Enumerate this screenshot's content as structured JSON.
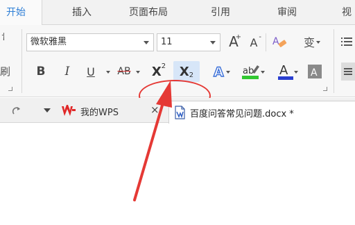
{
  "tabs": [
    "开始",
    "插入",
    "页面布局",
    "引用",
    "审阅",
    "视"
  ],
  "ribbon": {
    "left_char": "刷",
    "font_name": "微软雅黑",
    "font_size": "11",
    "bold": "B",
    "italic": "I",
    "underline": "U",
    "strike": "AB",
    "superscript_base": "X",
    "superscript_mark": "2",
    "subscript_base": "X",
    "subscript_mark": "2",
    "grow_font": "A",
    "shrink_font": "A",
    "clear_format_char": "A",
    "phonetic_char": "变"
  },
  "docbar": {
    "wps_label": "我的WPS",
    "close_glyph": "×",
    "file_title": "百度问答常见问题.docx *"
  },
  "colors": {
    "accent": "#2f7fd6",
    "highlight": "#e53935",
    "highlighter_green": "#32c832",
    "font_color_blue": "#2a3fd0"
  }
}
